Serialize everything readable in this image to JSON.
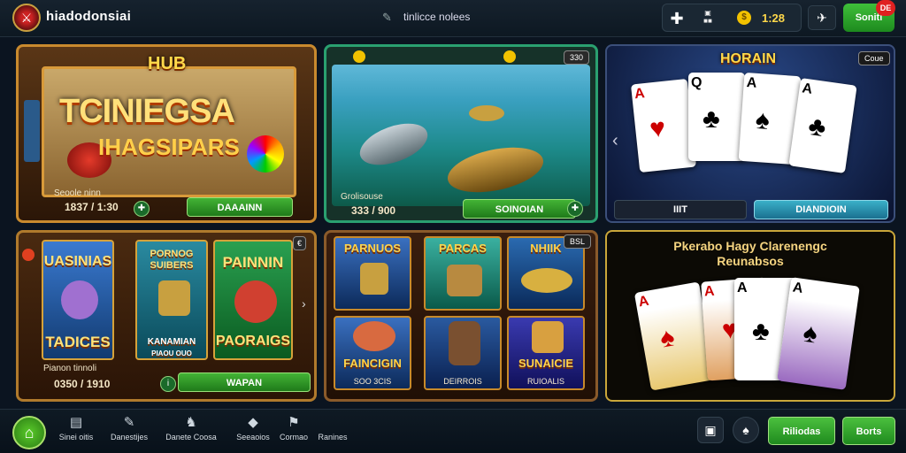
{
  "topbar": {
    "brand": "hiadodonsiai",
    "nav_text": "tinlicce nolees",
    "hud_chest_label": "■■",
    "hud_amount": "1:28",
    "badge": "DE",
    "top_button": "Soniti"
  },
  "cards": {
    "hub": {
      "title": "HUB",
      "big_line1": "TCINIEGSA",
      "big_line2": "IHAGSIPARS",
      "label": "Seoole ninn",
      "value": "1837 / 1:30",
      "button": "DAAAINN"
    },
    "fishing": {
      "label": "Grolisouse",
      "value": "333 / 900",
      "button": "SOINOIAN",
      "pill": "330"
    },
    "poker": {
      "title": "HORAIN",
      "pill": "Coue",
      "btn_left": "IIIT",
      "btn_right": "DIANDIOIN"
    },
    "slots": {
      "tag": "€",
      "items": [
        {
          "top": "UASINIAS",
          "bottom": "TADICES"
        },
        {
          "top": "PORNOG SUIBERS",
          "bottom": "KANAMIAN"
        },
        {
          "top": "PAINNIN",
          "bottom": "PAORAIGS"
        }
      ],
      "sub_label": "PIAOU OUO",
      "label": "Pianon tinnoli",
      "value": "0350 / 1910",
      "button": "WAPAN"
    },
    "grid": {
      "pill": "BSL",
      "tiles": [
        {
          "title": "PARNUOS",
          "sub": ""
        },
        {
          "title": "PARCAS",
          "sub": ""
        },
        {
          "title": "NHIIK",
          "sub": ""
        },
        {
          "title": "FAINCIGIN",
          "sub": "SOO 3CIS"
        },
        {
          "title": "",
          "sub": "DEIRROIS"
        },
        {
          "title": "SUNAICIE",
          "sub": "RUIOALIS"
        }
      ]
    },
    "challenge": {
      "title_line1": "Pkerabo Hagy Clarenengc",
      "title_line2": "Reunabsos"
    }
  },
  "bottombar": {
    "items": [
      {
        "label": "Sinei oitis"
      },
      {
        "label": "Danestijes"
      },
      {
        "label": "Danete Coosa"
      },
      {
        "label": "Seeaoios"
      },
      {
        "label": "Cormao"
      },
      {
        "label": "Ranines"
      }
    ],
    "btn_a": "Riliodas",
    "btn_b": "Borts"
  }
}
